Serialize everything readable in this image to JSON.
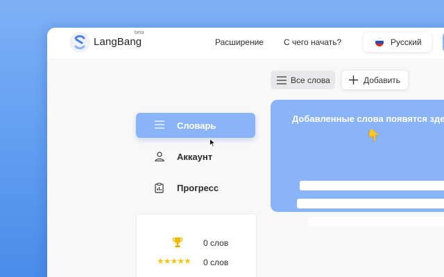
{
  "header": {
    "brand": "LangBang",
    "beta": "beta",
    "nav": [
      "Расширение",
      "С чего начать?"
    ],
    "language": {
      "label": "Русский",
      "flag": "russia-flag-icon"
    }
  },
  "toolbar": {
    "all_words": "Все слова",
    "add": "Добавить"
  },
  "sidebar": {
    "items": [
      {
        "label": "Словарь",
        "icon": "menu-icon",
        "active": true
      },
      {
        "label": "Аккаунт",
        "icon": "user-icon",
        "active": false
      },
      {
        "label": "Прогресс",
        "icon": "clipboard-chart-icon",
        "active": false
      }
    ]
  },
  "stats": [
    {
      "icon": "trophy-icon",
      "count": "0 слов"
    },
    {
      "icon": "five-stars-icon",
      "stars": "★★★★★",
      "count": "0 слов"
    }
  ],
  "empty_state": {
    "title": "Добавленные слова появятся здесь",
    "hand": "👇"
  },
  "colors": {
    "accent": "#8ab4f8",
    "background_gradient_top": "#7fb0f6",
    "background_gradient_bottom": "#4a8cea",
    "star": "#f5c518"
  }
}
